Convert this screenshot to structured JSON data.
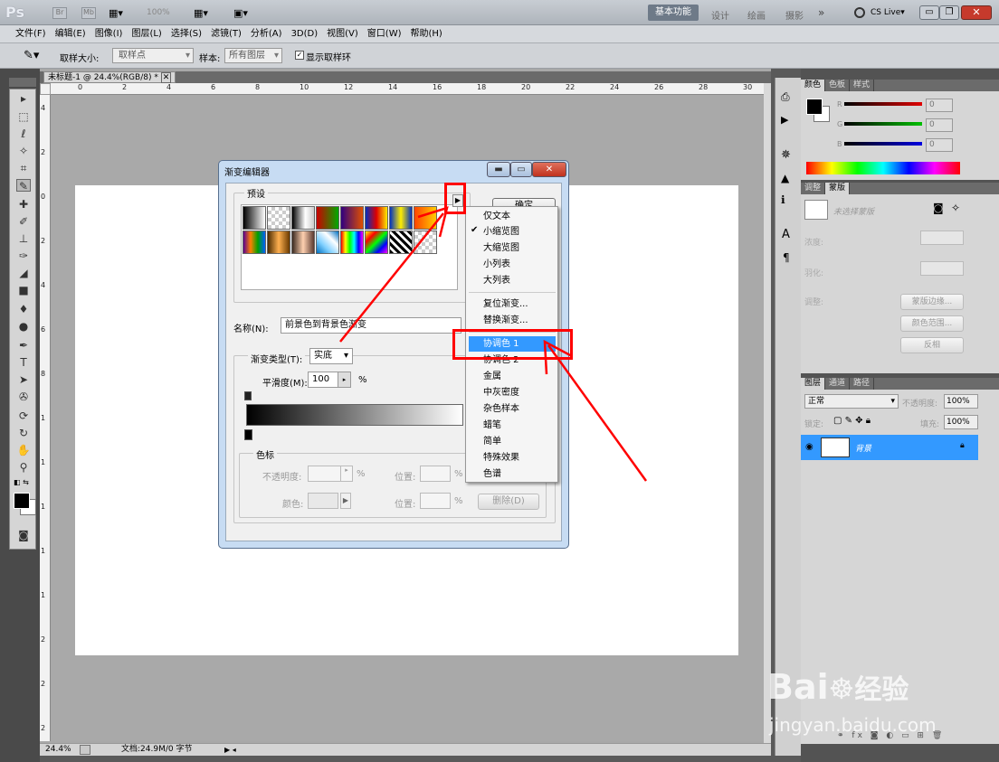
{
  "appbar": {
    "logo": "Ps",
    "br": "Br",
    "mb": "Mb",
    "zoom": "100%",
    "workspaces": [
      "基本功能",
      "设计",
      "绘画",
      "摄影"
    ],
    "more": "»",
    "cslive": "CS Live▾"
  },
  "menubar": [
    "文件(F)",
    "编辑(E)",
    "图像(I)",
    "图层(L)",
    "选择(S)",
    "滤镜(T)",
    "分析(A)",
    "3D(D)",
    "视图(V)",
    "窗口(W)",
    "帮助(H)"
  ],
  "options": {
    "sample_size_label": "取样大小:",
    "sample_size_value": "取样点",
    "sample_label": "样本:",
    "sample_value": "所有图层",
    "show_ring": "显示取样环"
  },
  "document": {
    "tab": "未标题-1 @ 24.4%(RGB/8) *",
    "ruler_h": [
      "0",
      "2",
      "4",
      "6",
      "8",
      "10",
      "12",
      "14",
      "16",
      "18",
      "20",
      "22",
      "24",
      "26",
      "28",
      "30"
    ],
    "ruler_v": [
      "4",
      "2",
      "0",
      "2",
      "4",
      "6",
      "8",
      "1",
      "1",
      "1",
      "1",
      "1",
      "2",
      "2",
      "2"
    ],
    "zoom": "24.4%",
    "docinfo": "文档:24.9M/0 字节"
  },
  "dialog": {
    "title": "渐变编辑器",
    "presets_label": "预设",
    "ok": "确定",
    "name_label": "名称(N):",
    "name_value": "前景色到背景色渐变",
    "type_label": "渐变类型(T):",
    "type_value": "实底",
    "smooth_label": "平滑度(M):",
    "smooth_value": "100",
    "percent": "%",
    "stops_label": "色标",
    "opacity_label": "不透明度:",
    "location_label": "位置:",
    "color_label": "颜色:",
    "delete": "删除(D)",
    "gradient_from": "#000000",
    "gradient_to": "#ffffff"
  },
  "menu": {
    "items": [
      "仅文本",
      "小缩览图",
      "大缩览图",
      "小列表",
      "大列表"
    ],
    "checked": "小缩览图",
    "items2": [
      "复位渐变...",
      "替换渐变..."
    ],
    "highlight": "协调色 1",
    "items3": [
      "协调色 2",
      "金属",
      "中灰密度",
      "杂色样本",
      "蜡笔",
      "简单",
      "特殊效果",
      "色谱"
    ]
  },
  "panels": {
    "color_tabs": [
      "颜色",
      "色板",
      "样式"
    ],
    "rgb": [
      {
        "label": "R",
        "value": "0",
        "color": "#e00000"
      },
      {
        "label": "G",
        "value": "0",
        "color": "#00c000"
      },
      {
        "label": "B",
        "value": "0",
        "color": "#0000e0"
      }
    ],
    "adj_tabs": [
      "调整",
      "蒙版"
    ],
    "mask_status": "未选择蒙版",
    "density_label": "浓度:",
    "feather_label": "羽化:",
    "refine_label": "调整:",
    "mask_edge": "蒙版边缘...",
    "color_range": "颜色范围...",
    "invert": "反相",
    "layer_tabs": [
      "图层",
      "通道",
      "路径"
    ],
    "blend_mode": "正常",
    "opacity_label": "不透明度:",
    "opacity_value": "100%",
    "lock_label": "锁定:",
    "fill_label": "填充:",
    "fill_value": "100%",
    "layer_name": "背景"
  },
  "watermark": {
    "text1": "Bai",
    "text2": "经验",
    "text3": "jingyan.baidu.com"
  },
  "colors": {
    "accent": "#3399ff",
    "highlight_bg": "#3399ff",
    "annotation": "#ff0000"
  }
}
